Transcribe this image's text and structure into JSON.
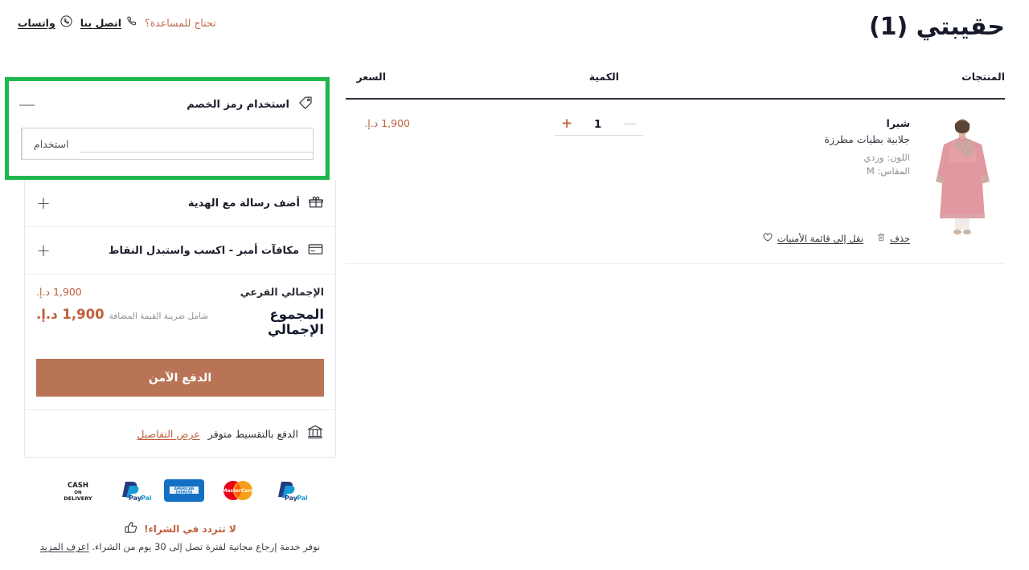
{
  "topbar": {
    "help_label": "تحتاج للمساعدة؟",
    "phone_icon": "phone-icon",
    "call_link": "اتصل بنا",
    "whatsapp_icon": "whatsapp-icon",
    "whatsapp_link": "واتساب"
  },
  "header": {
    "cart_title": "حقيبتي (1)"
  },
  "cart_table": {
    "columns": {
      "products": "المنتجات",
      "quantity": "الكمية",
      "price": "السعر"
    },
    "items": [
      {
        "brand": "شيرا",
        "name": "جلابية بطيات مطرزة",
        "color_label": "اللون: وردي",
        "size_label": "المقاس: M",
        "qty_value": "1",
        "qty_increase": "+",
        "qty_decrease": "—",
        "price": "1,900 د.إ.",
        "wishlist_icon": "heart-icon",
        "wishlist_label": "نقل إلى قائمة الأمنيات",
        "delete_icon": "trash-icon",
        "delete_label": "حذف"
      }
    ]
  },
  "summary": {
    "coupon": {
      "icon": "tag-icon",
      "label": "استخدام رمز الخصم",
      "toggle": "—",
      "input_value": "",
      "input_placeholder": "",
      "apply_label": "استخدام",
      "highlight_color": "#1eb74e"
    },
    "gift": {
      "icon": "gift-icon",
      "label": "أضف رسالة مع الهدية",
      "toggle": "+"
    },
    "rewards": {
      "icon": "card-icon",
      "label": "مكافآت أمبر - اكسب واستبدل النقاط",
      "toggle": "+"
    },
    "subtotal": {
      "label": "الإجمالي الفرعي",
      "value": "1,900 د.إ."
    },
    "grand_total": {
      "label": "المجموع الإجمالي",
      "vat_note": "شامل ضريبة القيمة المضافة",
      "value": "1,900 د.إ."
    },
    "checkout_label": "الدفع الآمن",
    "checkout_color": "#b97356",
    "installment": {
      "icon": "bank-icon",
      "text": "الدفع بالتقسيط متوفر",
      "link": "عرض التفاصيل"
    }
  },
  "payment_methods": [
    {
      "name": "cash-on-delivery-badge",
      "line1": "CASH",
      "line2": "ON",
      "line3": "DELIVERY"
    },
    {
      "name": "paypal-badge",
      "line1": "PayPal"
    },
    {
      "name": "amex-badge",
      "line1": "AMERICAN",
      "line2": "EXPRESS"
    },
    {
      "name": "mastercard-badge",
      "line1": "MasterCard"
    },
    {
      "name": "paypal-badge-2",
      "line1": "PayPal"
    }
  ],
  "reassurance": {
    "icon": "thumbs-up-icon",
    "title": "لا تتردد في الشراء!",
    "subtitle": "نوفر خدمة إرجاع مجانية لفترة تصل إلى 30 يوم من الشراء.",
    "link": "اعرف المزيد"
  }
}
